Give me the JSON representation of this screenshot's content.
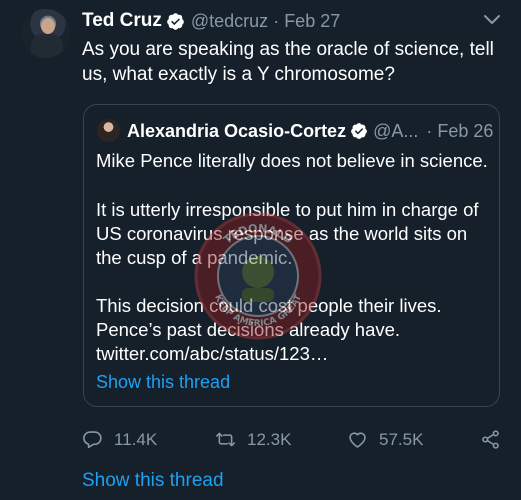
{
  "author": {
    "name": "Ted Cruz",
    "handle": "@tedcruz",
    "separator": "·",
    "date": "Feb 27",
    "verified": true
  },
  "tweet": {
    "text": "As you are speaking as the oracle of science, tell us, what exactly is a Y chromosome?"
  },
  "quoted": {
    "name": "Alexandria Ocasio-Cortez",
    "handle": "@A...",
    "separator": "·",
    "date": "Feb 26",
    "verified": true,
    "paragraph1": "Mike Pence literally does not believe in science.",
    "paragraph2": "It is utterly irresponsible to put him in charge of US coronavirus response as the world sits on the cusp of a pandemic.",
    "paragraph3_line1": "This decision could cost people their lives.",
    "paragraph3_line2": "Pence’s past decisions already have.",
    "link": "twitter.com/abc/status/123…",
    "show_thread": "Show this thread"
  },
  "actions": {
    "replies": "11.4K",
    "retweets": "12.3K",
    "likes": "57.5K"
  },
  "show_thread": "Show this thread",
  "icons": {
    "verified": "verified-badge-icon",
    "menu": "chevron-down-icon",
    "reply": "reply-icon",
    "retweet": "retweet-icon",
    "like": "heart-icon",
    "share": "share-icon"
  },
  "watermark": {
    "text_top": "TEDONALD",
    "text_bottom": "KEEP AMERICA GREAT"
  },
  "colors": {
    "background": "#15202b",
    "text": "#ffffff",
    "muted": "#8899a6",
    "accent": "#1da1f2",
    "border": "#38444d"
  }
}
